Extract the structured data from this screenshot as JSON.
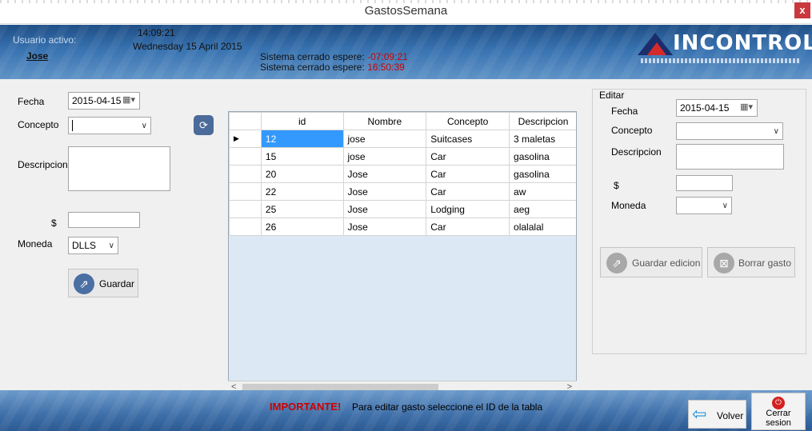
{
  "window": {
    "title": "GastosSemana",
    "close_label": "x"
  },
  "header": {
    "user_label": "Usuario activo:",
    "user_name": "Jose",
    "time": "14:09:21",
    "date": "Wednesday 15 April 2015",
    "status_1_label": "Sistema cerrado espere:",
    "status_1_value": "-07:09:21",
    "status_2_label": "Sistema cerrado espere:",
    "status_2_value": "16:50:39",
    "logo_text": "INCONTROL"
  },
  "form": {
    "fecha_label": "Fecha",
    "fecha_value": "2015-04-15",
    "concepto_label": "Concepto",
    "concepto_value": "",
    "descripcion_label": "Descripcion",
    "monto_label": "$",
    "moneda_label": "Moneda",
    "moneda_value": "DLLS",
    "save_button": "Guardar"
  },
  "grid": {
    "columns": [
      "id",
      "Nombre",
      "Concepto",
      "Descripcion"
    ],
    "rows": [
      [
        "12",
        "jose",
        "Suitcases",
        "3 maletas"
      ],
      [
        "15",
        "jose",
        "Car",
        "gasolina"
      ],
      [
        "20",
        "Jose",
        "Car",
        "gasolina"
      ],
      [
        "22",
        "Jose",
        "Car",
        "aw"
      ],
      [
        "25",
        "Jose",
        "Lodging",
        "aeg"
      ],
      [
        "26",
        "Jose",
        "Car",
        "olalalal"
      ]
    ],
    "selected_row": 0
  },
  "edit": {
    "title": "Editar",
    "fecha_label": "Fecha",
    "fecha_value": "2015-04-15",
    "concepto_label": "Concepto",
    "descripcion_label": "Descripcion",
    "monto_label": "$",
    "moneda_label": "Moneda",
    "save_button": "Guardar edicion",
    "delete_button": "Borrar gasto"
  },
  "footer": {
    "important_label": "IMPORTANTE!",
    "important_text": "Para editar gasto seleccione el ID de la tabla",
    "back_button": "Volver",
    "logout_button_line1": "Cerrar",
    "logout_button_line2": "sesion"
  },
  "colors": {
    "accent": "#3399ff",
    "header": "#3872b0",
    "warning": "#d20000"
  }
}
